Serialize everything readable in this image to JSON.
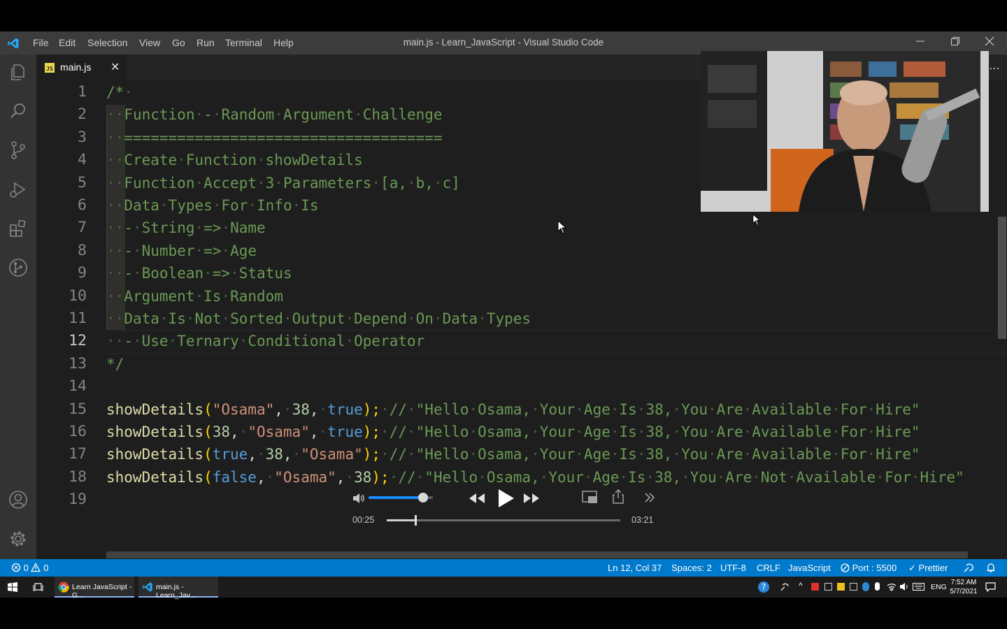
{
  "window": {
    "title": "main.js - Learn_JavaScript - Visual Studio Code",
    "menu": [
      "File",
      "Edit",
      "Selection",
      "View",
      "Go",
      "Run",
      "Terminal",
      "Help"
    ]
  },
  "activity_bar": {
    "icons": [
      "explorer-icon",
      "search-icon",
      "source-control-icon",
      "run-debug-icon",
      "extensions-icon",
      "git-graph-icon",
      "account-icon",
      "settings-gear-icon"
    ]
  },
  "tab": {
    "label": "main.js",
    "icon_text": "JS",
    "close": "✕"
  },
  "editor": {
    "line_numbers": [
      "1",
      "2",
      "3",
      "4",
      "5",
      "6",
      "7",
      "8",
      "9",
      "10",
      "11",
      "12",
      "13",
      "14",
      "15",
      "16",
      "17",
      "18",
      "19"
    ],
    "active_line": 12,
    "comment_lines": [
      "/*·",
      "··Function·-·Random·Argument·Challenge",
      "··====================================",
      "··Create·Function·showDetails",
      "··Function·Accept·3·Parameters·[a,·b,·c]",
      "··Data·Types·For·Info·Is",
      "··-·String·=>·Name",
      "··-·Number·=>·Age",
      "··-·Boolean·=>·Status",
      "··Argument·Is·Random",
      "··Data·Is·Not·Sorted·Output·Depend·On·Data·Types",
      "··-·Use·Ternary·Conditional·Operator",
      "*/"
    ],
    "calls": [
      {
        "fn": "showDetails",
        "open": "(",
        "a1": "\"Osama\"",
        "a2": "38",
        "a3": "true",
        "close": ");",
        "comment": "·//·\"Hello·Osama,·Your·Age·Is·38,·You·Are·Available·For·Hire\""
      },
      {
        "fn": "showDetails",
        "open": "(",
        "a1": "38",
        "a2": "\"Osama\"",
        "a3": "true",
        "close": ");",
        "comment": "·//·\"Hello·Osama,·Your·Age·Is·38,·You·Are·Available·For·Hire\""
      },
      {
        "fn": "showDetails",
        "open": "(",
        "a1": "true",
        "a2": "38",
        "a3": "\"Osama\"",
        "close": ");",
        "comment": "·//·\"Hello·Osama,·Your·Age·Is·38,·You·Are·Available·For·Hire\""
      },
      {
        "fn": "showDetails",
        "open": "(",
        "a1": "false",
        "a2": "\"Osama\"",
        "a3": "38",
        "close": ");",
        "comment": "·//·\"Hello·Osama,·Your·Age·Is·38,·You·Are·Not·Available·For·Hire\""
      }
    ]
  },
  "media_player": {
    "current_time": "00:25",
    "duration": "03:21",
    "progress": 0.124,
    "volume": 0.85
  },
  "status_bar": {
    "errors": "0",
    "warnings": "0",
    "position": "Ln 12, Col 37",
    "spaces": "Spaces: 2",
    "encoding": "UTF-8",
    "eol": "CRLF",
    "language": "JavaScript",
    "port": "Port : 5500",
    "prettier": "Prettier"
  },
  "taskbar": {
    "apps": [
      {
        "label": "Learn JavaScript - G..."
      },
      {
        "label": "main.js - Learn_Jav..."
      }
    ],
    "lang": "ENG",
    "time": "7:52 AM",
    "date": "5/7/2021"
  },
  "colors": {
    "status_bar": "#007acc",
    "editor_bg": "#1e1e1e",
    "comment": "#6a9955",
    "function": "#dcdcaa",
    "string": "#ce9178",
    "keyword": "#569cd6"
  }
}
